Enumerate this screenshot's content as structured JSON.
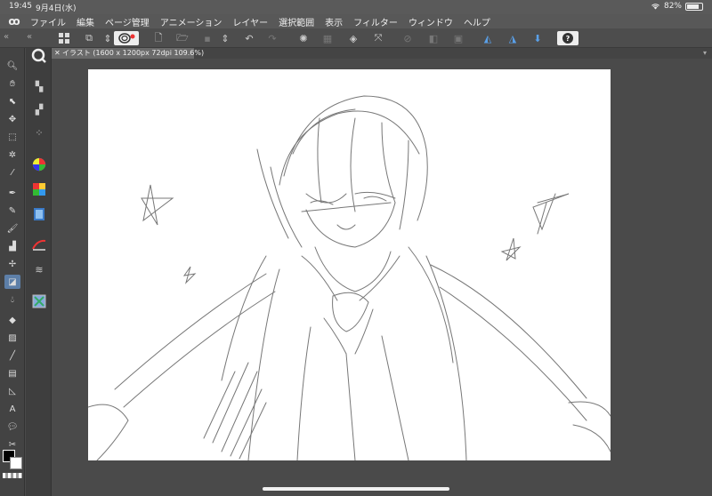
{
  "status": {
    "time": "19:45",
    "date": "9月4日(水)",
    "battery_label": "82%",
    "battery_level": 0.82
  },
  "menu": {
    "logo_icon": "clip-studio-logo-icon",
    "items": [
      "ファイル",
      "編集",
      "ページ管理",
      "アニメーション",
      "レイヤー",
      "選択範囲",
      "表示",
      "フィルター",
      "ウィンドウ",
      "ヘルプ"
    ]
  },
  "toolbar": {
    "collapse_left": "«",
    "collapse_right": "«",
    "help_label": "?"
  },
  "document": {
    "tab_title": "イラスト (1600 x 1200px 72dpi 109.6%)"
  },
  "colors": {
    "main": "#000000",
    "sub": "#ffffff"
  }
}
